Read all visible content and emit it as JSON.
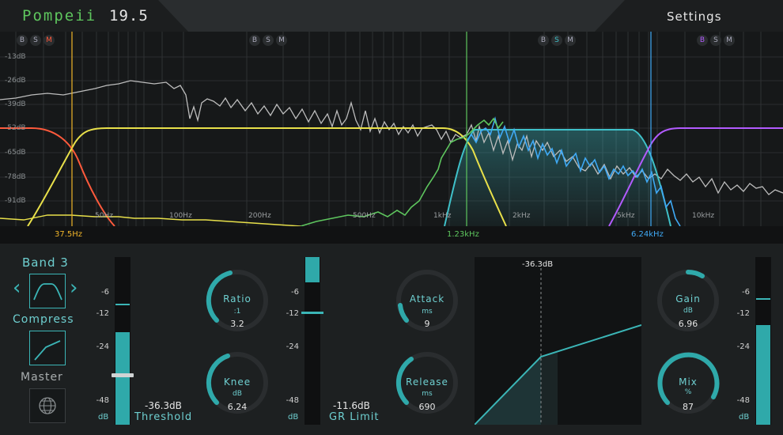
{
  "header": {
    "app_name": "Pompeii",
    "version": "19.5",
    "settings_label": "Settings"
  },
  "spectrum": {
    "db_labels": [
      "-13dB",
      "-26dB",
      "-39dB",
      "-52dB",
      "-65dB",
      "-78dB",
      "-91dB"
    ],
    "freq_labels": [
      "50Hz",
      "100Hz",
      "200Hz",
      "500Hz",
      "1kHz",
      "2kHz",
      "5kHz",
      "10kHz"
    ],
    "band_buttons": [
      {
        "b": "B",
        "s": "S",
        "m": "M",
        "active": "M",
        "active_color": "#ff5a3c"
      },
      {
        "b": "B",
        "s": "S",
        "m": "M",
        "active": "",
        "active_color": ""
      },
      {
        "b": "B",
        "s": "S",
        "m": "M",
        "active": "S",
        "active_color": "#3fc1c9"
      },
      {
        "b": "B",
        "s": "S",
        "m": "M",
        "active": "B",
        "active_color": "#b25bff"
      }
    ],
    "crossovers": [
      {
        "label": "37.5Hz",
        "color": "#f0b429"
      },
      {
        "label": "1.23kHz",
        "color": "#5ec65e"
      },
      {
        "label": "6.24kHz",
        "color": "#3fa9f5"
      }
    ]
  },
  "band_panel": {
    "band_title": "Band 3",
    "mode_label": "Compress",
    "master_label": "Master",
    "nav_prev": "‹",
    "nav_next": "›",
    "filter_icon": "bandpass-icon",
    "mode_icon": "compressor-curve-icon",
    "master_icon": "globe-icon"
  },
  "threshold": {
    "ticks": [
      "-6",
      "-12",
      "-24",
      "-48"
    ],
    "unit": "dB",
    "value": "-36.3dB",
    "label": "Threshold"
  },
  "ratio": {
    "label": "Ratio",
    "unit": ":1",
    "value": "3.2"
  },
  "knee": {
    "label": "Knee",
    "unit": "dB",
    "value": "6.24"
  },
  "gr_limit": {
    "ticks": [
      "-6",
      "-12",
      "-24",
      "-48"
    ],
    "unit": "dB",
    "value": "-11.6dB",
    "label": "GR Limit"
  },
  "attack": {
    "label": "Attack",
    "unit": "ms",
    "value": "9"
  },
  "release": {
    "label": "Release",
    "unit": "ms",
    "value": "690"
  },
  "transfer": {
    "threshold_label": "-36.3dB"
  },
  "gain": {
    "label": "Gain",
    "unit": "dB",
    "value": "6.96"
  },
  "mix": {
    "label": "Mix",
    "unit": "%",
    "value": "87"
  },
  "output": {
    "ticks": [
      "-6",
      "-12",
      "-24",
      "-48"
    ],
    "unit": "dB"
  },
  "colors": {
    "accent": "#3bb5b6",
    "label": "#6ecfd0",
    "band1": "#ff5a3c",
    "band2": "#e8e04a",
    "band3": "#3fc1c9",
    "band4": "#b25bff",
    "spectrum": "#bdbdbd",
    "green_trace": "#5ec65e"
  }
}
